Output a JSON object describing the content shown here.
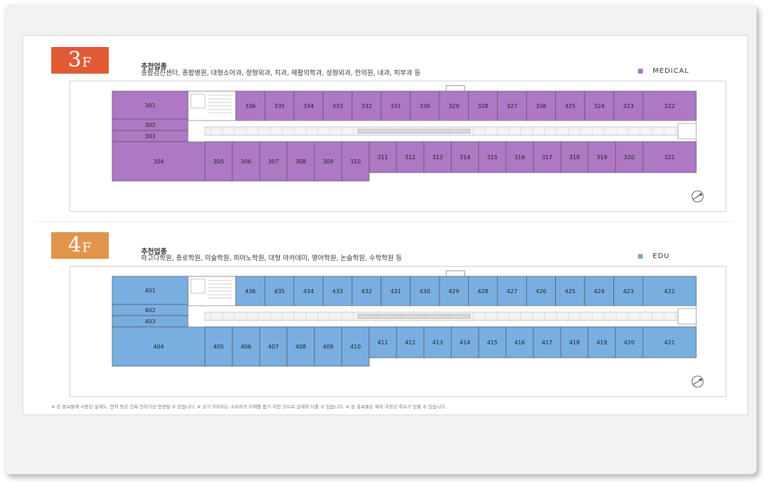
{
  "floors": [
    {
      "id": "3f",
      "badge_number": "3",
      "badge_letter": "F",
      "badge_color": "#e05a36",
      "fill_color": "#ae78c4",
      "recommend_title": "추천업종",
      "recommend_list": "종합검진센터, 종합병원, 대형소아과, 정형외과, 치과, 재활의학과, 성형외과, 한의원, 내과, 피부과 등",
      "legend_label": "MEDICAL",
      "legend_color": "#ae78c4",
      "rooms": {
        "left_upper": "301",
        "left_mid1": "302",
        "left_mid2": "303",
        "left_lower": "304",
        "top_row": [
          "336",
          "335",
          "334",
          "333",
          "332",
          "331",
          "330",
          "329",
          "328",
          "327",
          "326",
          "325",
          "324",
          "323",
          "322"
        ],
        "bottom_row": [
          "305",
          "306",
          "307",
          "308",
          "309",
          "310",
          "311",
          "312",
          "313",
          "314",
          "315",
          "316",
          "317",
          "318",
          "319",
          "320",
          "321"
        ]
      }
    },
    {
      "id": "4f",
      "badge_number": "4",
      "badge_letter": "F",
      "badge_color": "#e2954a",
      "fill_color": "#78afe0",
      "recommend_title": "추천업종",
      "recommend_list": "파고다학원, 종로학원, 미술학원, 피아노학원, 대형 아카데미, 영어학원, 논술학원, 수학학원 등",
      "legend_label": "EDU",
      "legend_color": "#78afe0",
      "rooms": {
        "left_upper": "401",
        "left_mid1": "402",
        "left_mid2": "403",
        "left_lower": "404",
        "top_row": [
          "436",
          "435",
          "434",
          "433",
          "432",
          "431",
          "430",
          "429",
          "428",
          "427",
          "426",
          "425",
          "424",
          "423",
          "422"
        ],
        "bottom_row": [
          "405",
          "406",
          "407",
          "408",
          "409",
          "410",
          "411",
          "412",
          "413",
          "414",
          "415",
          "416",
          "417",
          "418",
          "419",
          "420",
          "421"
        ]
      }
    }
  ],
  "footnote": "※ 본 홍보물에 사용된 설계도, 면적 등은 건축 인허가상 변경될 수 있습니다.   ※ 상기 이미지는 소비자의 이해를 돕기 위한 것으로 실제와 다를 수 있습니다.   ※ 본 홍보물은 제작 과정상 착오가 있을 수 있습니다."
}
